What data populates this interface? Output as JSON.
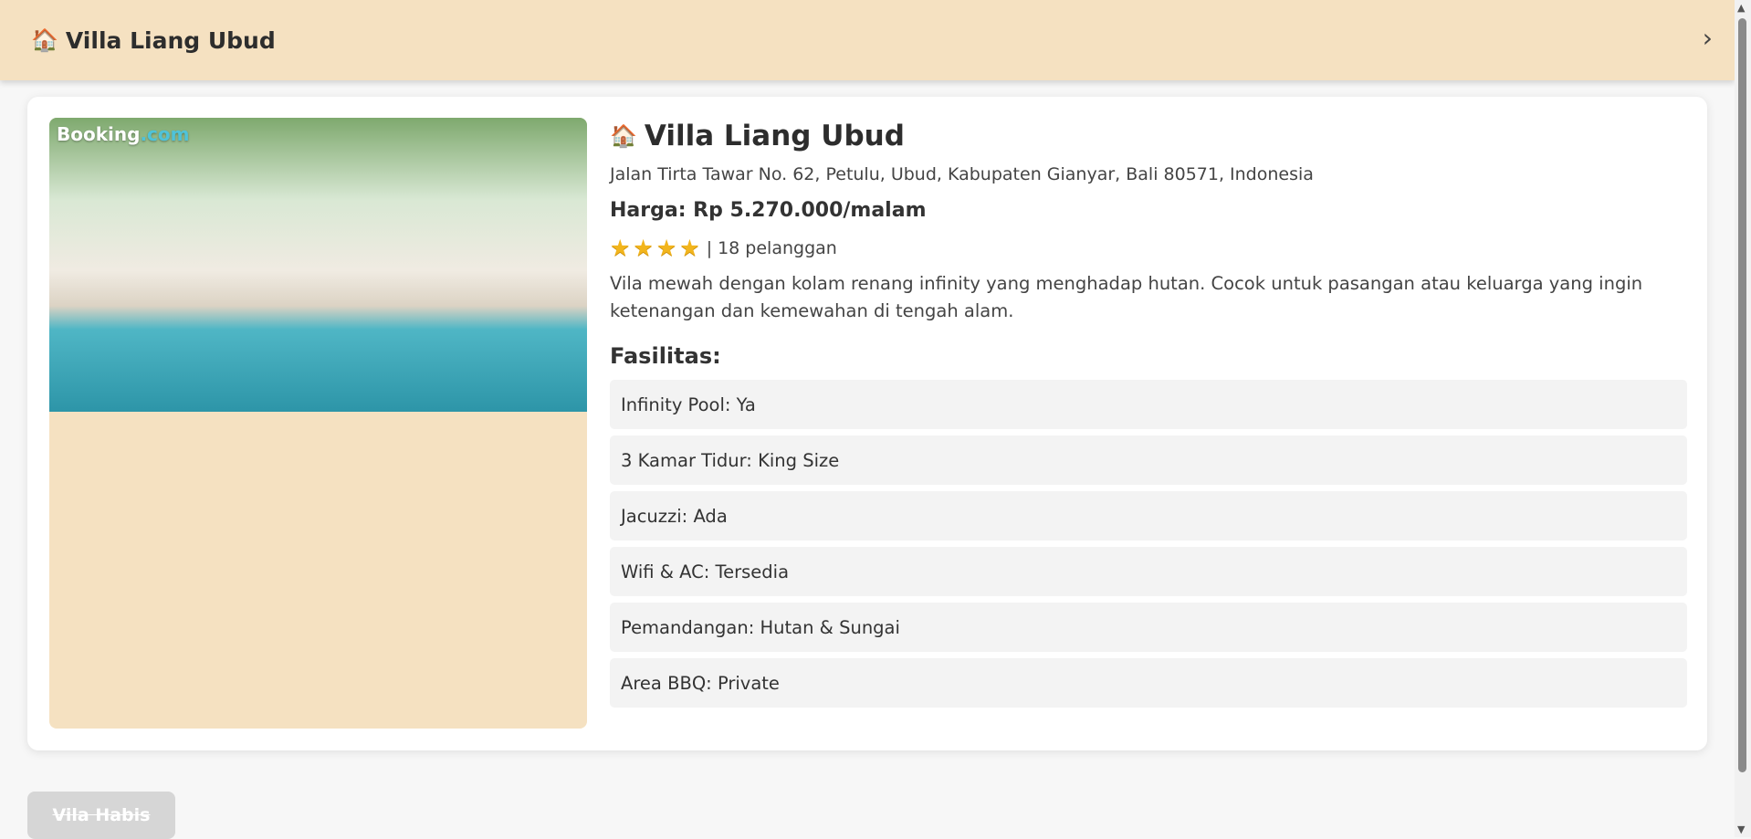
{
  "header": {
    "title": "Villa Liang Ubud",
    "icon": "house-icon",
    "next_icon": "chevron-right-icon",
    "background": "#f5e1c1"
  },
  "villa": {
    "photo_watermark": "Booking.com",
    "title": "Villa Liang Ubud",
    "address": "Jalan Tirta Tawar No. 62, Petulu, Ubud, Kabupaten Gianyar, Bali 80571, Indonesia",
    "price": "Harga: Rp 5.270.000/malam",
    "rating": {
      "stars": 4,
      "separator": "|",
      "reviews": "18 pelanggan"
    },
    "description": "Vila mewah dengan kolam renang infinity yang menghadap hutan. Cocok untuk pasangan atau keluarga yang ingin ketenangan dan kemewahan di tengah alam.",
    "facilities_title": "Fasilitas:",
    "facilities": [
      "Infinity Pool: Ya",
      "3 Kamar Tidur: King Size",
      "Jacuzzi: Ada",
      "Wifi & AC: Tersedia",
      "Pemandangan: Hutan & Sungai",
      "Area BBQ: Private"
    ]
  },
  "soldout_button": {
    "label": "Vila Habis"
  },
  "colors": {
    "star": "#f2b51d",
    "card": "#ffffff",
    "facility_bg": "#f3f3f3"
  }
}
